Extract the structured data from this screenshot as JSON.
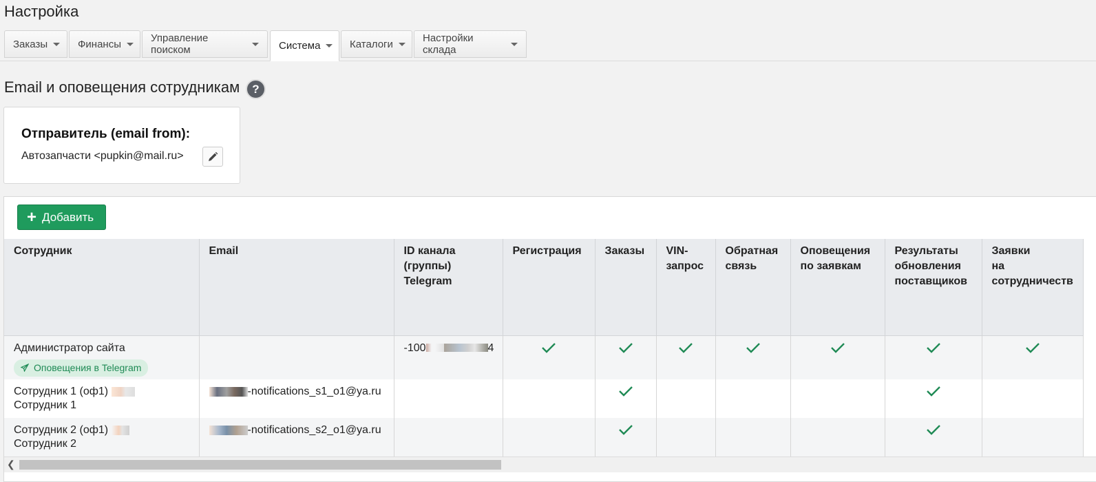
{
  "page": {
    "title": "Настройка"
  },
  "tabs": [
    {
      "label": "Заказы",
      "active": false
    },
    {
      "label": "Финансы",
      "active": false
    },
    {
      "label": "Управление поиском",
      "active": false
    },
    {
      "label": "Система",
      "active": true
    },
    {
      "label": "Каталоги",
      "active": false
    },
    {
      "label": "Настройки склада",
      "active": false
    }
  ],
  "section": {
    "title": "Email и оповещения сотрудникам",
    "help_icon": "question-circle-icon"
  },
  "sender": {
    "label": "Отправитель (email from):",
    "value": "Автозапчасти <pupkin@mail.ru>",
    "edit_icon": "pencil-icon"
  },
  "add_button": {
    "label": "Добавить",
    "icon": "plus-icon",
    "color": "#1f9b5d"
  },
  "table": {
    "columns": [
      {
        "lines": [
          "Сотрудник"
        ]
      },
      {
        "lines": [
          "Email"
        ]
      },
      {
        "lines": [
          "ID канала",
          "(группы)",
          "Telegram"
        ]
      },
      {
        "lines": [
          "Регистрация"
        ]
      },
      {
        "lines": [
          "Заказы"
        ]
      },
      {
        "lines": [
          "VIN-",
          "запрос"
        ]
      },
      {
        "lines": [
          "Обратная",
          "связь"
        ]
      },
      {
        "lines": [
          "Оповещения",
          "по заявкам"
        ]
      },
      {
        "lines": [
          "Результаты",
          "обновления",
          "поставщиков"
        ]
      },
      {
        "lines": [
          "Заявки",
          "на",
          "сотрудничеств"
        ]
      }
    ],
    "rows": [
      {
        "name_lines": [
          "Администратор сайта"
        ],
        "badge": "Оповещения в Telegram",
        "email": "",
        "telegram_id_prefix": "-100",
        "telegram_id_suffix": "4",
        "checks": [
          true,
          true,
          true,
          true,
          true,
          true,
          true
        ]
      },
      {
        "name_lines": [
          "Сотрудник 1 (оф1)",
          "Сотрудник 1"
        ],
        "badge": "",
        "email": "-notifications_s1_o1@ya.ru",
        "telegram_id_prefix": "",
        "telegram_id_suffix": "",
        "checks": [
          false,
          true,
          false,
          false,
          false,
          true,
          false
        ]
      },
      {
        "name_lines": [
          "Сотрудник 2 (оф1)",
          "Сотрудник 2"
        ],
        "badge": "",
        "email": "-notifications_s2_o1@ya.ru",
        "telegram_id_prefix": "",
        "telegram_id_suffix": "",
        "checks": [
          false,
          true,
          false,
          false,
          false,
          true,
          false
        ]
      }
    ],
    "check_icon": "checkmark-icon",
    "check_color": "#1f8a55"
  }
}
